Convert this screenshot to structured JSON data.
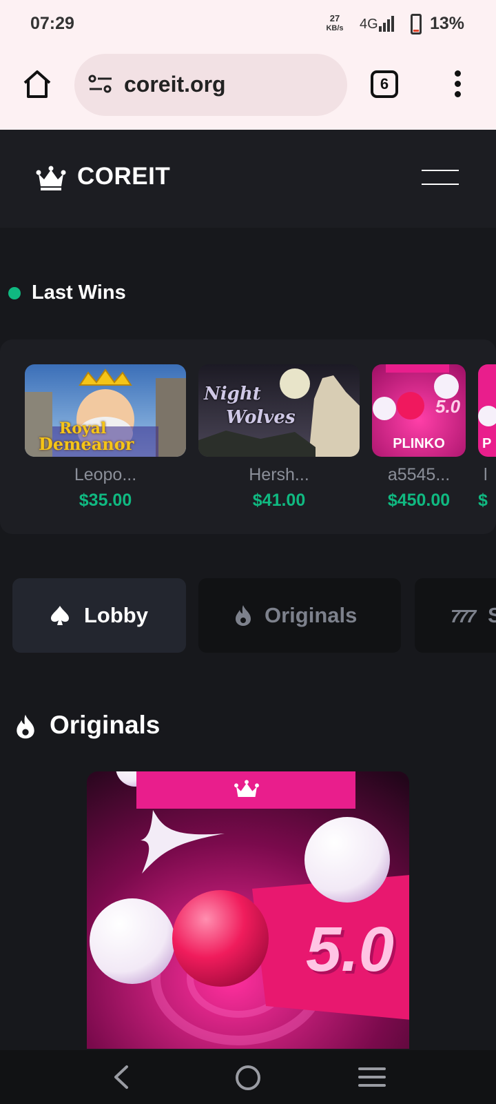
{
  "status_bar": {
    "time": "07:29",
    "speed_value": "27",
    "speed_unit": "KB/s",
    "network": "4G",
    "battery": "13%"
  },
  "browser": {
    "url": "coreit.org",
    "tab_count": "6"
  },
  "site": {
    "brand": "COREIT",
    "accent_green": "#10b981",
    "accent_pink": "#e91e8c"
  },
  "last_wins": {
    "title": "Last Wins",
    "items": [
      {
        "game": "Royal Demeanor",
        "game_line1": "Royal",
        "game_line2": "Demeanor",
        "user": "Leopo...",
        "amount": "$35.00"
      },
      {
        "game": "Night Wolves",
        "game_line1": "Night",
        "game_line2": "Wolves",
        "user": "Hersh...",
        "amount": "$41.00"
      },
      {
        "game": "PLINKO",
        "multiplier": "5.0",
        "user": "a5545...",
        "amount": "$450.00"
      },
      {
        "game": "PLINKO",
        "game_short": "P",
        "user": "l",
        "amount": "$"
      }
    ]
  },
  "categories": [
    {
      "label": "Lobby",
      "icon": "spade-icon",
      "active": true
    },
    {
      "label": "Originals",
      "icon": "fire-icon",
      "active": false
    },
    {
      "label": "S",
      "icon": "slots-777-icon",
      "active": false
    }
  ],
  "originals": {
    "title": "Originals",
    "featured_multiplier": "5.0"
  }
}
